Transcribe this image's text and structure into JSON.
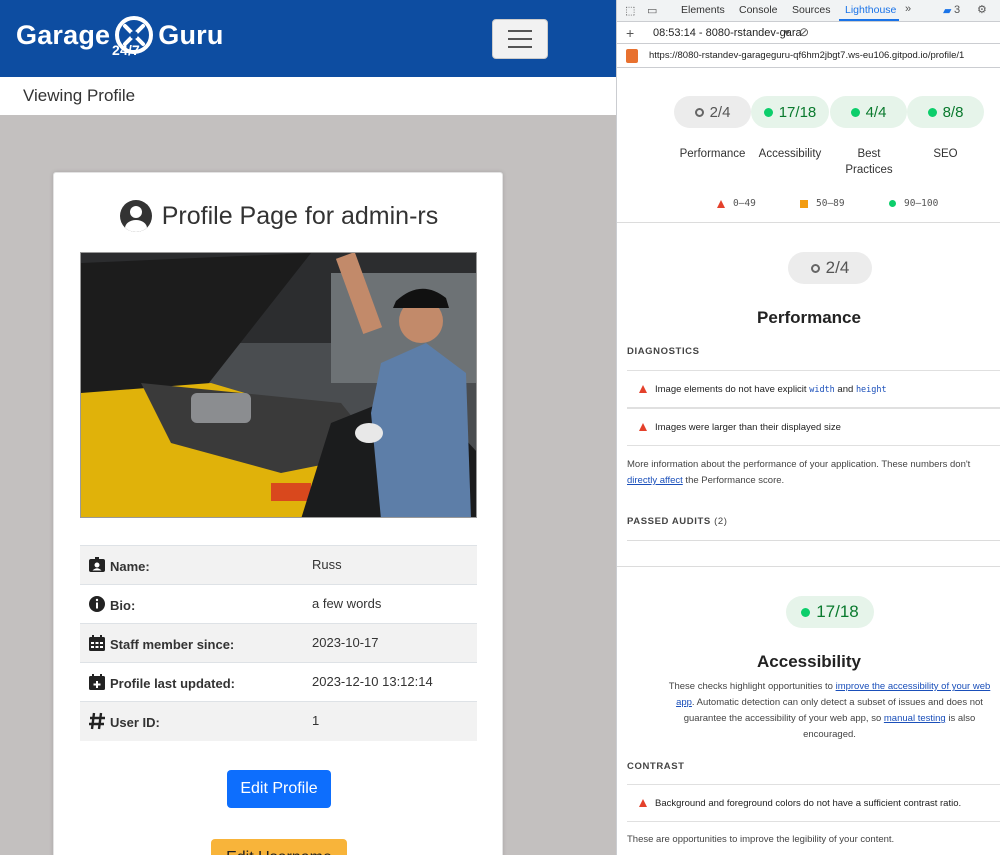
{
  "app": {
    "brand_left": "Garage",
    "brand_right": "Guru",
    "brand_tagline": "24/7",
    "breadcrumb": "Viewing Profile",
    "profile_title": "Profile Page for admin-rs",
    "fields": [
      {
        "label": "Name:",
        "value": "Russ",
        "icon": "id-card-icon"
      },
      {
        "label": "Bio:",
        "value": "a few words",
        "icon": "info-icon"
      },
      {
        "label": "Staff member since:",
        "value": "2023-10-17",
        "icon": "calendar-icon"
      },
      {
        "label": "Profile last updated:",
        "value": "2023-12-10 13:12:14",
        "icon": "calendar-plus-icon"
      },
      {
        "label": "User ID:",
        "value": "1",
        "icon": "hash-icon"
      }
    ],
    "edit_profile_label": "Edit Profile",
    "edit_username_label": "Edit Username",
    "colors": {
      "navbar": "#0d4da1",
      "primary": "#0d6efd",
      "warning": "#f8b43a"
    }
  },
  "devtools": {
    "tabs": [
      "Elements",
      "Console",
      "Sources",
      "Lighthouse"
    ],
    "active_tab": "Lighthouse",
    "issues_count": "3",
    "report_label": "08:53:14 - 8080-rstandev-gara",
    "url": "https://8080-rstandev-garageguru-qf6hm2jbgt7.ws-eu106.gitpod.io/profile/1",
    "scores": [
      {
        "label": "Performance",
        "value": "2/4",
        "status": "grey"
      },
      {
        "label": "Accessibility",
        "value": "17/18",
        "status": "green"
      },
      {
        "label": "Best Practices",
        "value": "4/4",
        "status": "green"
      },
      {
        "label": "SEO",
        "value": "8/8",
        "status": "green"
      }
    ],
    "legend": [
      "0–49",
      "50–89",
      "90–100"
    ],
    "performance": {
      "score": "2/4",
      "title": "Performance",
      "diagnostics_heading": "DIAGNOSTICS",
      "audit1_pre": "Image elements do not have explicit ",
      "audit1_code1": "width",
      "audit1_mid": " and ",
      "audit1_code2": "height",
      "audit2": "Images were larger than their displayed size",
      "info_pre": "More information about the performance of your application. These numbers don't ",
      "info_link": "directly affect",
      "info_post": " the Performance score.",
      "passed_heading": "PASSED AUDITS",
      "passed_count": "(2)"
    },
    "accessibility": {
      "score": "17/18",
      "title": "Accessibility",
      "desc_pre": "These checks highlight opportunities to ",
      "desc_link1": "improve the accessibility of your web app",
      "desc_mid": ". Automatic detection can only detect a subset of issues and does not guarantee the accessibility of your web app, so ",
      "desc_link2": "manual testing",
      "desc_post": " is also encouraged.",
      "contrast_heading": "CONTRAST",
      "audit1": "Background and foreground colors do not have a sufficient contrast ratio.",
      "footer": "These are opportunities to improve the legibility of your content."
    }
  }
}
